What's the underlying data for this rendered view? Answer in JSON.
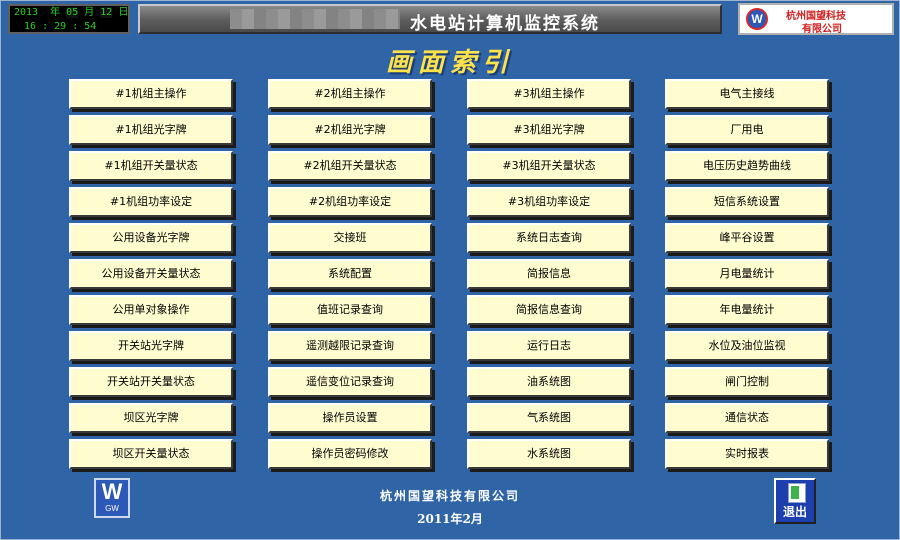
{
  "header": {
    "clock": {
      "year": "2013",
      "year_unit": "年",
      "month": "05",
      "month_unit": "月",
      "day": "12",
      "day_unit": "日",
      "hour": "16",
      "minute": "29",
      "second": "54",
      "separator": ":"
    },
    "system_title": "水电站计算机监控系统",
    "company_logo_line1": "杭州国望科技",
    "company_logo_line2": "有限公司"
  },
  "page_title": "画面索引",
  "menu": {
    "columns": [
      [
        "#1机组主操作",
        "#1机组光字牌",
        "#1机组开关量状态",
        "#1机组功率设定",
        "公用设备光字牌",
        "公用设备开关量状态",
        "公用单对象操作",
        "开关站光字牌",
        "开关站开关量状态",
        "坝区光字牌",
        "坝区开关量状态"
      ],
      [
        "#2机组主操作",
        "#2机组光字牌",
        "#2机组开关量状态",
        "#2机组功率设定",
        "交接班",
        "系统配置",
        "值班记录查询",
        "遥测越限记录查询",
        "遥信变位记录查询",
        "操作员设置",
        "操作员密码修改"
      ],
      [
        "#3机组主操作",
        "#3机组光字牌",
        "#3机组开关量状态",
        "#3机组功率设定",
        "系统日志查询",
        "简报信息",
        "简报信息查询",
        "运行日志",
        "油系统图",
        "气系统图",
        "水系统图"
      ],
      [
        "电气主接线",
        "厂用电",
        "电压历史趋势曲线",
        "短信系统设置",
        "峰平谷设置",
        "月电量统计",
        "年电量统计",
        "水位及油位监视",
        "闸门控制",
        "通信状态",
        "实时报表"
      ]
    ]
  },
  "footer": {
    "company": "杭州国望科技有限公司",
    "date": "2011年2月",
    "logo_caption": "GW",
    "exit_label": "退出"
  }
}
